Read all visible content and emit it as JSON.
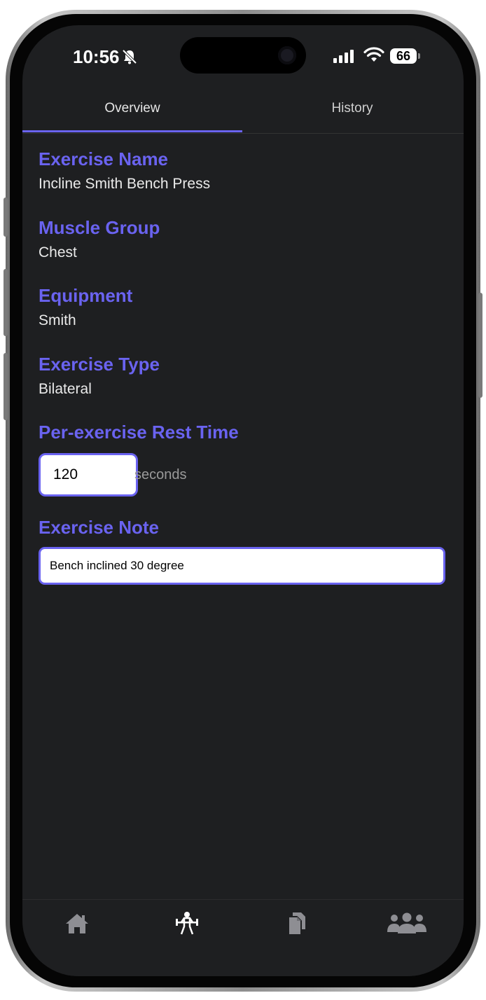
{
  "status_bar": {
    "time": "10:56",
    "battery": "66"
  },
  "tabs": [
    {
      "label": "Overview",
      "active": true
    },
    {
      "label": "History",
      "active": false
    }
  ],
  "fields": {
    "exercise_name": {
      "label": "Exercise Name",
      "value": "Incline Smith Bench Press"
    },
    "muscle_group": {
      "label": "Muscle Group",
      "value": "Chest"
    },
    "equipment": {
      "label": "Equipment",
      "value": "Smith"
    },
    "exercise_type": {
      "label": "Exercise Type",
      "value": "Bilateral"
    },
    "rest_time": {
      "label": "Per-exercise Rest Time",
      "value": "120",
      "unit": "seconds"
    },
    "note": {
      "label": "Exercise Note",
      "value": "Bench inclined 30 degree"
    }
  },
  "nav": {
    "items": [
      {
        "icon": "home-icon",
        "active": false
      },
      {
        "icon": "weightlifter-icon",
        "active": true
      },
      {
        "icon": "documents-icon",
        "active": false
      },
      {
        "icon": "users-icon",
        "active": false
      }
    ]
  },
  "colors": {
    "accent": "#6a63f0",
    "background": "#1e1f21",
    "text": "#eaeaea",
    "muted": "#9a9a9a"
  }
}
